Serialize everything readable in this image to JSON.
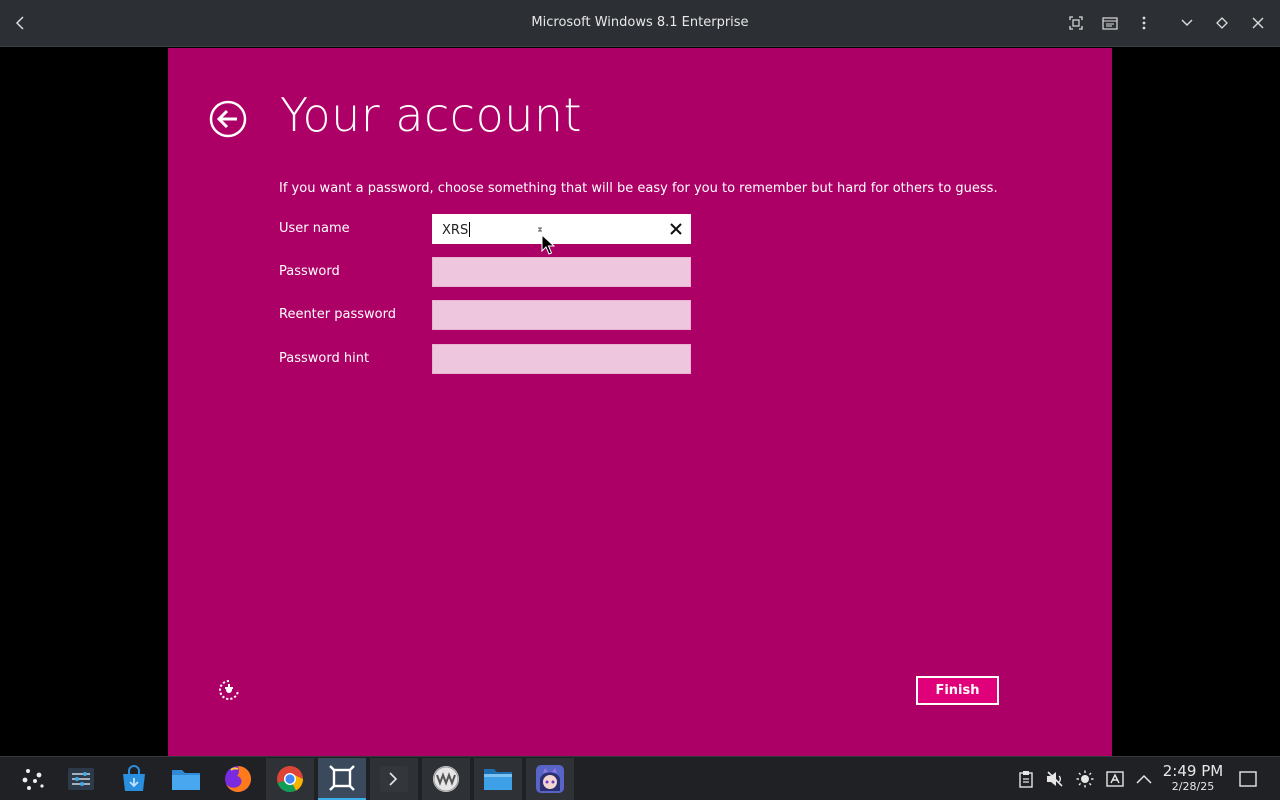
{
  "window": {
    "title": "Microsoft Windows 8.1 Enterprise"
  },
  "setup": {
    "page_title": "Your account",
    "instructions": "If you want a password, choose something that will be easy for you to remember but hard for others to guess.",
    "fields": [
      {
        "label": "User name",
        "value": "XRS"
      },
      {
        "label": "Password",
        "value": ""
      },
      {
        "label": "Reenter password",
        "value": ""
      },
      {
        "label": "Password hint",
        "value": ""
      }
    ],
    "finish_label": "Finish"
  },
  "colors": {
    "oobe_background": "#ac0066",
    "finish_button": "#e0007a",
    "field_inactive": "#eec6dd"
  },
  "taskbar": {
    "apps": [
      "app-launcher-icon",
      "settings-icon",
      "store-icon",
      "folder-icon",
      "firefox-icon",
      "chrome-icon",
      "vm-manager-icon",
      "terminal-icon",
      "vmware-icon",
      "file-manager-icon",
      "anime-app-icon"
    ],
    "tray": [
      "clipboard-icon",
      "volume-muted-icon",
      "brightness-icon",
      "keyboard-layout-icon",
      "tray-expand-icon"
    ],
    "time": "2:49 PM",
    "date": "2/28/25"
  }
}
